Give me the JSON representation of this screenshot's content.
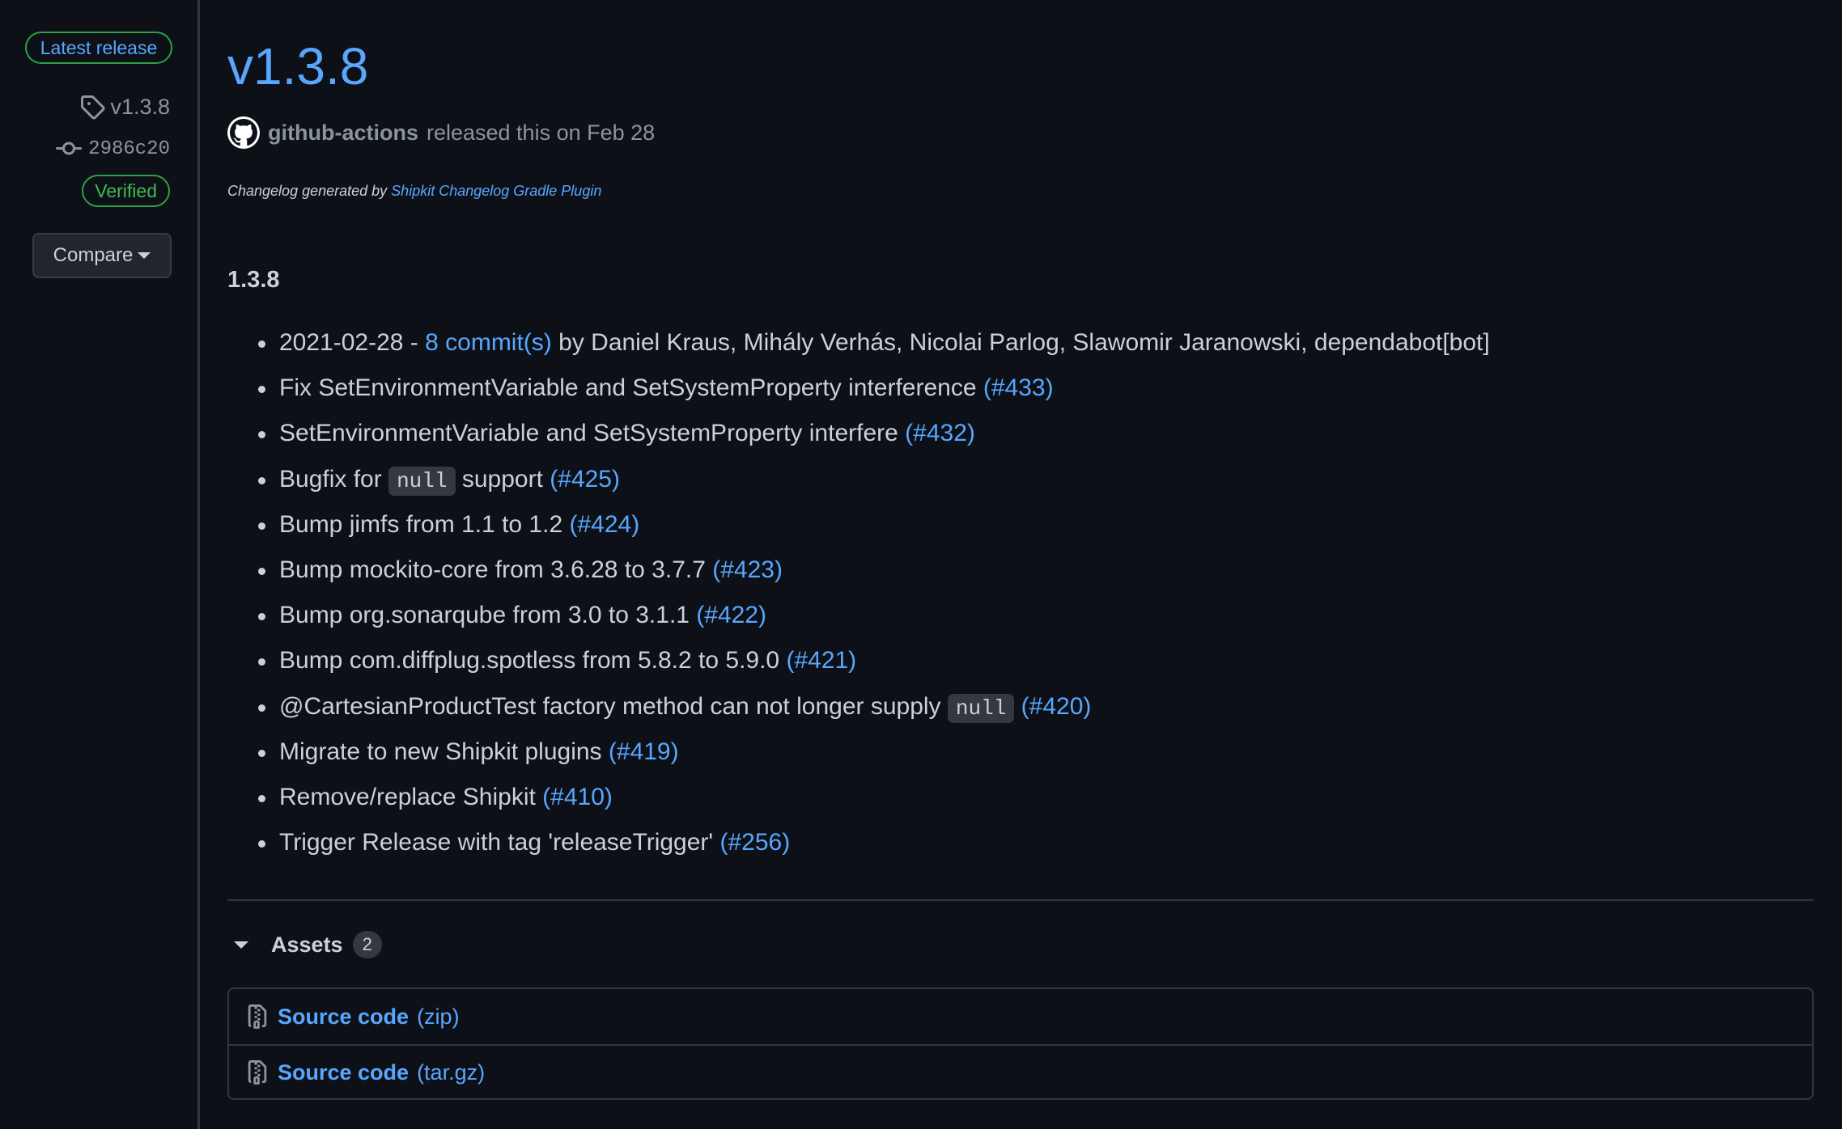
{
  "sidebar": {
    "latest_label": "Latest release",
    "tag": "v1.3.8",
    "commit": "2986c20",
    "verified_label": "Verified",
    "compare_label": "Compare"
  },
  "release": {
    "title": "v1.3.8",
    "author": "github-actions",
    "released_text": "released this on Feb 28",
    "changelog_prefix": "Changelog generated by",
    "changelog_link": "Shipkit Changelog Gradle Plugin",
    "version_heading": "1.3.8"
  },
  "changes": [
    {
      "pre": "2021-02-28 - ",
      "link": "8 commit(s)",
      "post": " by Daniel Kraus, Mihály Verhás, Nicolai Parlog, Slawomir Jaranowski, dependabot[bot]"
    },
    {
      "text": "Fix SetEnvironmentVariable and SetSystemProperty interference",
      "ref": "(#433)"
    },
    {
      "text": "SetEnvironmentVariable and SetSystemProperty interfere",
      "ref": "(#432)"
    },
    {
      "text": "Bugfix for",
      "code": "null",
      "text2": "support",
      "ref": "(#425)"
    },
    {
      "text": "Bump jimfs from 1.1 to 1.2",
      "ref": "(#424)"
    },
    {
      "text": "Bump mockito-core from 3.6.28 to 3.7.7",
      "ref": "(#423)"
    },
    {
      "text": "Bump org.sonarqube from 3.0 to 3.1.1",
      "ref": "(#422)"
    },
    {
      "text": "Bump com.diffplug.spotless from 5.8.2 to 5.9.0",
      "ref": "(#421)"
    },
    {
      "text": "@CartesianProductTest factory method can not longer supply",
      "code": "null",
      "ref": "(#420)"
    },
    {
      "text": "Migrate to new Shipkit plugins",
      "ref": "(#419)"
    },
    {
      "text": "Remove/replace Shipkit",
      "ref": "(#410)"
    },
    {
      "text": "Trigger Release with tag 'releaseTrigger'",
      "ref": "(#256)"
    }
  ],
  "assets": {
    "title": "Assets",
    "count": "2",
    "items": [
      {
        "name": "Source code",
        "ext": "(zip)"
      },
      {
        "name": "Source code",
        "ext": "(tar.gz)"
      }
    ]
  },
  "icons": {
    "tag": "tag-icon",
    "commit": "git-commit-icon",
    "avatar": "github-mark-icon",
    "archive": "file-zip-icon"
  },
  "colors": {
    "background": "#0d1117",
    "link": "#58a6ff",
    "green": "#2ea043",
    "text": "#c9d1d9",
    "muted": "#8b949e"
  }
}
